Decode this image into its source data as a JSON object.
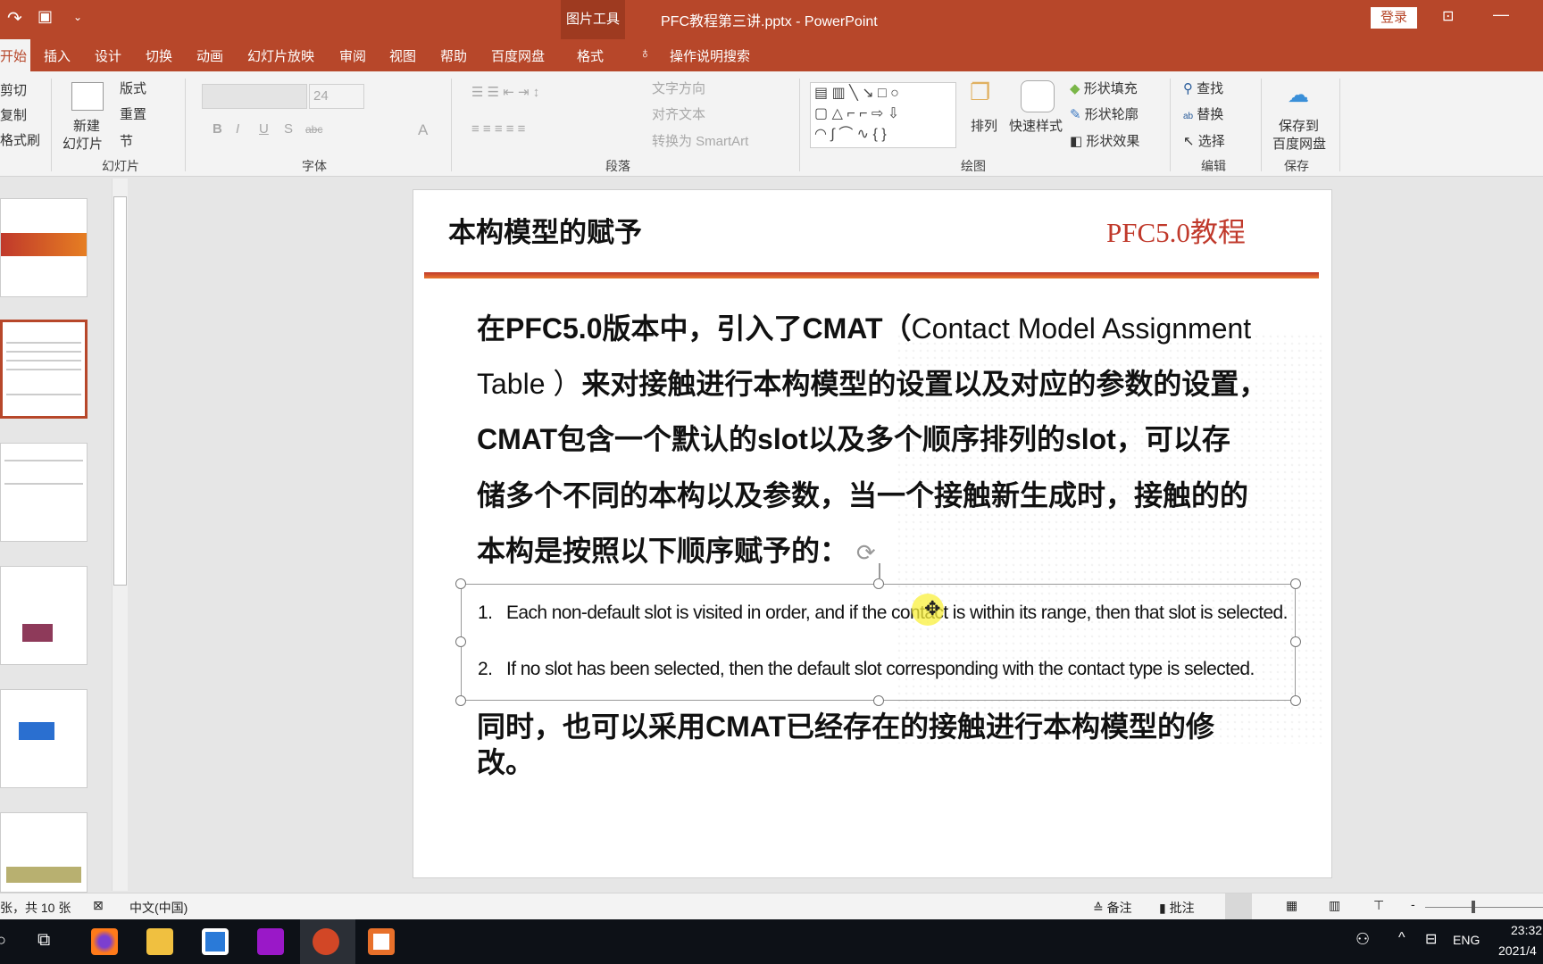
{
  "titlebar": {
    "context_tool": "图片工具",
    "title": "PFC教程第三讲.pptx  -  PowerPoint",
    "login": "登录"
  },
  "tabs": [
    "开始",
    "插入",
    "设计",
    "切换",
    "动画",
    "幻灯片放映",
    "审阅",
    "视图",
    "帮助",
    "百度网盘",
    "格式"
  ],
  "tell_me": "操作说明搜索",
  "ribbon": {
    "clipboard": [
      "剪切",
      "复制",
      "格式刷"
    ],
    "slides": {
      "new_slide": "新建",
      "new_slide2": "幻灯片",
      "layout": "版式",
      "reset": "重置",
      "section": "节",
      "group": "幻灯片"
    },
    "font": {
      "size": "24",
      "group": "字体"
    },
    "paragraph": {
      "text_direction": "文字方向",
      "align_text": "对齐文本",
      "smartart": "转换为 SmartArt",
      "group": "段落"
    },
    "drawing": {
      "arrange": "排列",
      "quick_styles": "快速样式",
      "fill": "形状填充",
      "outline": "形状轮廓",
      "effects": "形状效果",
      "group": "绘图"
    },
    "editing": {
      "find": "查找",
      "replace": "替换",
      "select": "选择",
      "group": "编辑"
    },
    "save": {
      "label1": "保存到",
      "label2": "百度网盘",
      "group": "保存"
    }
  },
  "slide": {
    "title": "本构模型的赋予",
    "brand": "PFC5.0教程",
    "para1": [
      {
        "b": "在PFC5.0版本中，引入了CMAT（",
        "n": "Contact Model Assignment"
      },
      {
        "n": "Table ）",
        "b": "来对接触进行本构模型的设置以及对应的参数的设置，"
      },
      {
        "b": "CMAT包含一个默认的slot以及多个顺序排列的slot，可以存"
      },
      {
        "b": "储多个不同的本构以及参数，当一个接触新生成时，接触的的"
      },
      {
        "b": "本构是按照以下顺序赋予的："
      }
    ],
    "list": [
      {
        "num": "1.",
        "text": "Each non-default slot is visited in order, and if the contact is within its range, then that slot is selected."
      },
      {
        "num": "2.",
        "text": "If no slot has been selected, then the default slot corresponding with the contact type is selected."
      }
    ],
    "para2": [
      "同时，也可以采用CMAT已经存在的接触进行本构模型的修",
      "改。"
    ]
  },
  "status": {
    "slide_count": "张，共 10 张",
    "language": "中文(中国)",
    "notes": "备注",
    "comments": "批注"
  },
  "taskbar": {
    "lang": "ENG",
    "time": "23:32",
    "date": "2021/4"
  },
  "colors": {
    "accent": "#b7472a",
    "brand_red": "#c0392b",
    "rule": "#d9531e"
  }
}
